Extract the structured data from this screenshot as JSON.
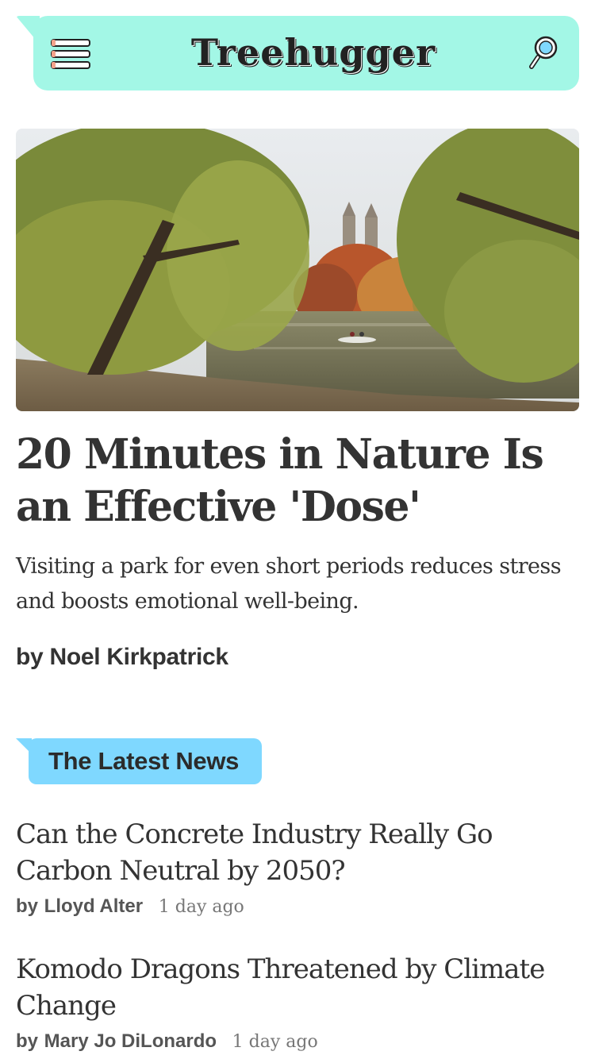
{
  "header": {
    "logo_text": "Treehugger",
    "bg_color": "#a3f7e6",
    "menu_icon": "hamburger-menu-icon",
    "search_icon": "magnifier-search-icon"
  },
  "hero": {
    "image_alt": "Willow trees by a lake in Central Park with a rowboat",
    "title": "20 Minutes in Nature Is an Effective 'Dose'",
    "dek": "Visiting a park for even short periods reduces stress and boosts emotional well-being.",
    "byline_prefix": "by",
    "author": "Noel Kirkpatrick"
  },
  "latest": {
    "label": "The Latest News",
    "badge_color": "#7fd8ff",
    "items": [
      {
        "title": "Can the Concrete Industry Really Go Carbon Neutral by 2050?",
        "byline_prefix": "by",
        "author": "Lloyd Alter",
        "time": "1 day ago"
      },
      {
        "title": "Komodo Dragons Threatened by Climate Change",
        "byline_prefix": "by",
        "author": "Mary Jo DiLonardo",
        "time": "1 day ago"
      }
    ]
  }
}
